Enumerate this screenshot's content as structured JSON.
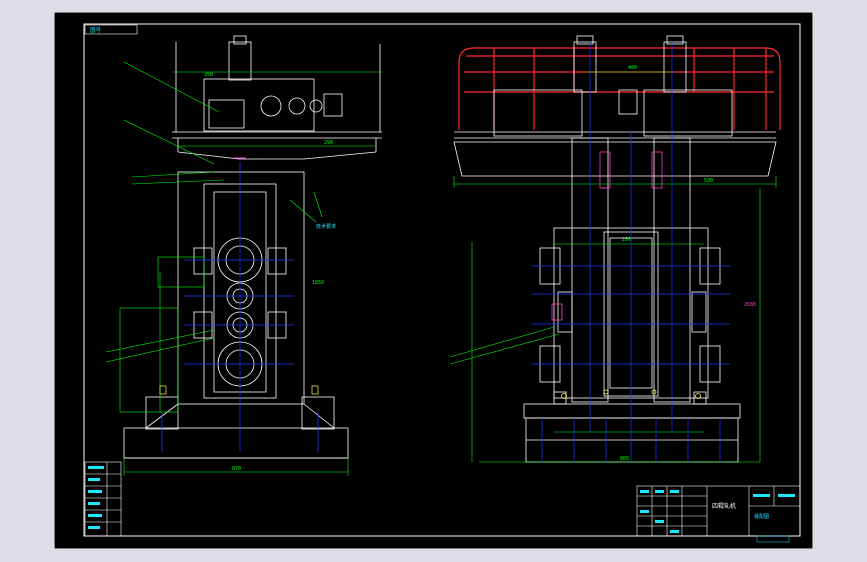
{
  "drawing": {
    "title_block_name": "四辊轧机",
    "title_block_label": "装配图",
    "corner_label": "图号",
    "tech_label": "技术要求"
  },
  "dimensions": {
    "left_top_span": "350",
    "left_mid_span": "290",
    "left_base_span": "870",
    "right_top_a": "400",
    "right_top_b": "530",
    "right_roll": "250",
    "right_base": "800"
  },
  "side_labels": {
    "right_view_height": "2680",
    "left_view_height": "1850"
  },
  "colors": {
    "background": "#000000",
    "outline": "#ffffff",
    "dimension": "#00ff00",
    "centerline": "#1e3cff",
    "railing": "#ff2b2b",
    "cyan": "#19e6ff",
    "magenta": "#ff3fc8",
    "yellow": "#ffff3a"
  }
}
